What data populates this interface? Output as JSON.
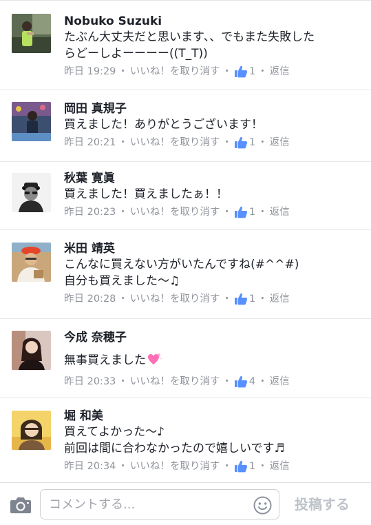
{
  "comments": [
    {
      "name": "Nobuko Suzuki",
      "lines": [
        "たぶん大丈夫だと思います、、でもまた失敗した",
        "らどーしよーーーー((T_T))"
      ],
      "time": "昨日 19:29",
      "unlike": "いいね！を取り消す",
      "likes": "1",
      "reply": "返信"
    },
    {
      "name": "岡田 真規子",
      "lines": [
        "買えました！ありがとうございます！"
      ],
      "time": "昨日 20:21",
      "unlike": "いいね！を取り消す",
      "likes": "1",
      "reply": "返信"
    },
    {
      "name": "秋葉 寛眞",
      "lines": [
        "買えました！買えましたぁ！！"
      ],
      "time": "昨日 20:23",
      "unlike": "いいね！を取り消す",
      "likes": "1",
      "reply": "返信"
    },
    {
      "name": "米田 靖英",
      "lines": [
        "こんなに買えない方がいたんですね(#^^#)",
        "自分も買えました〜♫"
      ],
      "time": "昨日 20:28",
      "unlike": "いいね！を取り消す",
      "likes": "1",
      "reply": "返信"
    },
    {
      "name": "今成 奈穂子",
      "lines": [
        "無事買えました"
      ],
      "time": "昨日 20:33",
      "unlike": "いいね！を取り消す",
      "likes": "4",
      "reply": "返信"
    },
    {
      "name": "堀 和美",
      "lines": [
        "買えてよかった〜♪",
        "前回は間に合わなかったので嬉しいです♬"
      ],
      "time": "昨日 20:34",
      "unlike": "いいね！を取り消す",
      "likes": "1",
      "reply": "返信"
    }
  ],
  "separator": "・",
  "composer": {
    "placeholder": "コメントする...",
    "post_label": "投稿する"
  },
  "icons": {
    "like": "thumbs-up-icon",
    "camera": "camera-icon",
    "emoji": "smiley-icon",
    "heart": "sparkling-heart-icon"
  },
  "colors": {
    "like_blue": "#5890ff",
    "meta_gray": "#90949c",
    "divider": "#e4e6eb"
  }
}
